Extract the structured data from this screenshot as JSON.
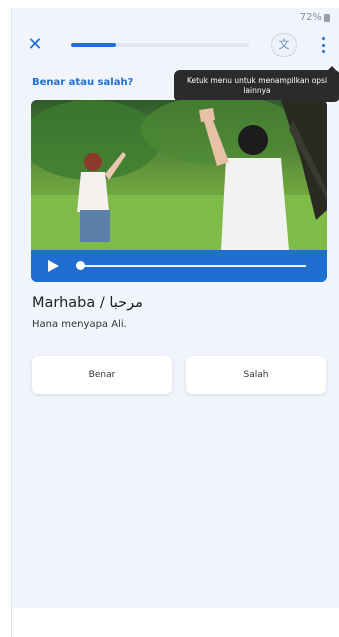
{
  "status_bar": {
    "battery_text": "72%"
  },
  "header": {
    "close_icon": "close-icon",
    "progress": 0.25,
    "translate_label": "文",
    "more_icon": "more-vertical-icon"
  },
  "question": "Benar atau salah?",
  "tooltip": "Ketuk menu untuk menampilkan opsi lainnya",
  "video": {
    "play_icon": "play-icon",
    "progress": 0.0
  },
  "phrase": "Marhaba / مرحبا",
  "sentence": "Hana menyapa Ali.",
  "answers": {
    "true_label": "Benar",
    "false_label": "Salah"
  },
  "colors": {
    "accent": "#1f6fd1",
    "background": "#f1f5fb",
    "tooltip_bg": "#2b2b2b"
  }
}
